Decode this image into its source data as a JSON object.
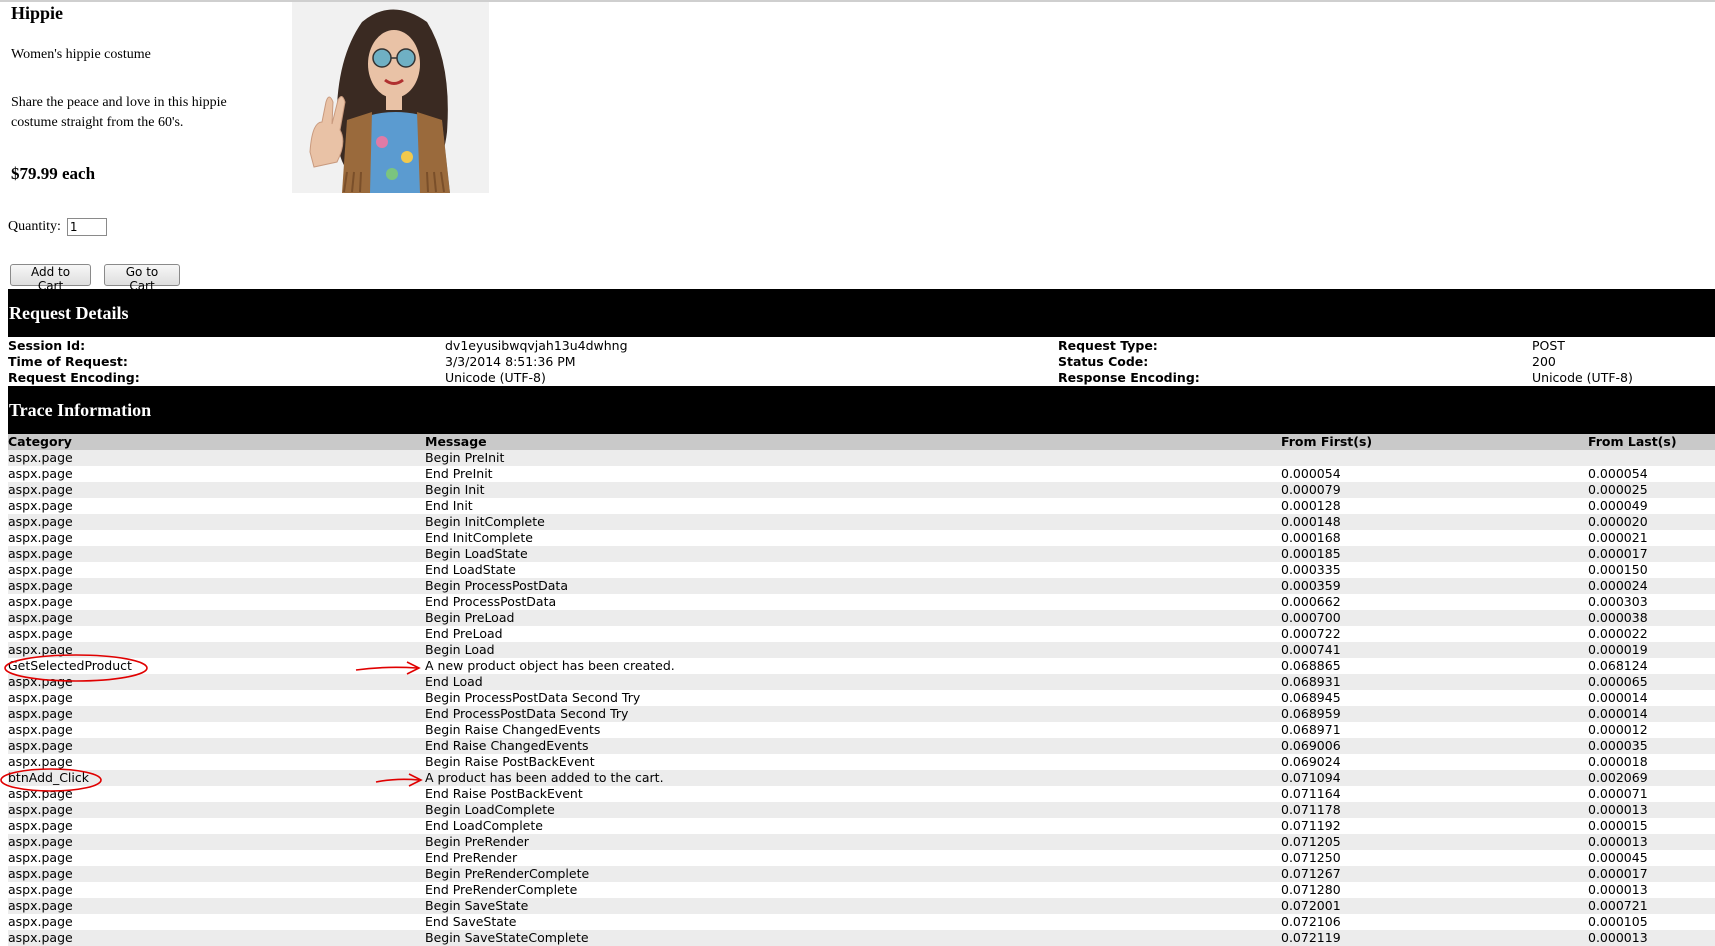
{
  "product": {
    "name": "Hippie",
    "short_description": "Women's hippie costume",
    "long_description": "Share the peace and love in this hippie costume straight from the 60's.",
    "price": "$79.99 each",
    "image_alt": "Women's hippie costume photo"
  },
  "cart_form": {
    "quantity_label": "Quantity:",
    "quantity_value": "1",
    "add_button": "Add to Cart",
    "go_button": "Go to Cart"
  },
  "request_details": {
    "title": "Request Details",
    "session_id_label": "Session Id:",
    "session_id": "dv1eyusibwqvjah13u4dwhng",
    "time_label": "Time of Request:",
    "time": "3/3/2014 8:51:36 PM",
    "req_encoding_label": "Request Encoding:",
    "req_encoding": "Unicode (UTF-8)",
    "request_type_label": "Request Type:",
    "request_type": "POST",
    "status_code_label": "Status Code:",
    "status_code": "200",
    "resp_encoding_label": "Response Encoding:",
    "resp_encoding": "Unicode (UTF-8)"
  },
  "trace": {
    "title": "Trace Information",
    "columns": [
      "Category",
      "Message",
      "From First(s)",
      "From Last(s)"
    ],
    "rows": [
      [
        "aspx.page",
        "Begin PreInit",
        "",
        ""
      ],
      [
        "aspx.page",
        "End PreInit",
        "0.000054",
        "0.000054"
      ],
      [
        "aspx.page",
        "Begin Init",
        "0.000079",
        "0.000025"
      ],
      [
        "aspx.page",
        "End Init",
        "0.000128",
        "0.000049"
      ],
      [
        "aspx.page",
        "Begin InitComplete",
        "0.000148",
        "0.000020"
      ],
      [
        "aspx.page",
        "End InitComplete",
        "0.000168",
        "0.000021"
      ],
      [
        "aspx.page",
        "Begin LoadState",
        "0.000185",
        "0.000017"
      ],
      [
        "aspx.page",
        "End LoadState",
        "0.000335",
        "0.000150"
      ],
      [
        "aspx.page",
        "Begin ProcessPostData",
        "0.000359",
        "0.000024"
      ],
      [
        "aspx.page",
        "End ProcessPostData",
        "0.000662",
        "0.000303"
      ],
      [
        "aspx.page",
        "Begin PreLoad",
        "0.000700",
        "0.000038"
      ],
      [
        "aspx.page",
        "End PreLoad",
        "0.000722",
        "0.000022"
      ],
      [
        "aspx.page",
        "Begin Load",
        "0.000741",
        "0.000019"
      ],
      [
        "GetSelectedProduct",
        "A new product object has been created.",
        "0.068865",
        "0.068124"
      ],
      [
        "aspx.page",
        "End Load",
        "0.068931",
        "0.000065"
      ],
      [
        "aspx.page",
        "Begin ProcessPostData Second Try",
        "0.068945",
        "0.000014"
      ],
      [
        "aspx.page",
        "End ProcessPostData Second Try",
        "0.068959",
        "0.000014"
      ],
      [
        "aspx.page",
        "Begin Raise ChangedEvents",
        "0.068971",
        "0.000012"
      ],
      [
        "aspx.page",
        "End Raise ChangedEvents",
        "0.069006",
        "0.000035"
      ],
      [
        "aspx.page",
        "Begin Raise PostBackEvent",
        "0.069024",
        "0.000018"
      ],
      [
        "btnAdd_Click",
        "A product has been added to the cart.",
        "0.071094",
        "0.002069"
      ],
      [
        "aspx.page",
        "End Raise PostBackEvent",
        "0.071164",
        "0.000071"
      ],
      [
        "aspx.page",
        "Begin LoadComplete",
        "0.071178",
        "0.000013"
      ],
      [
        "aspx.page",
        "End LoadComplete",
        "0.071192",
        "0.000015"
      ],
      [
        "aspx.page",
        "Begin PreRender",
        "0.071205",
        "0.000013"
      ],
      [
        "aspx.page",
        "End PreRender",
        "0.071250",
        "0.000045"
      ],
      [
        "aspx.page",
        "Begin PreRenderComplete",
        "0.071267",
        "0.000017"
      ],
      [
        "aspx.page",
        "End PreRenderComplete",
        "0.071280",
        "0.000013"
      ],
      [
        "aspx.page",
        "Begin SaveState",
        "0.072001",
        "0.000721"
      ],
      [
        "aspx.page",
        "End SaveState",
        "0.072106",
        "0.000105"
      ],
      [
        "aspx.page",
        "Begin SaveStateComplete",
        "0.072119",
        "0.000013"
      ]
    ]
  },
  "annotation_color": "#e00000"
}
